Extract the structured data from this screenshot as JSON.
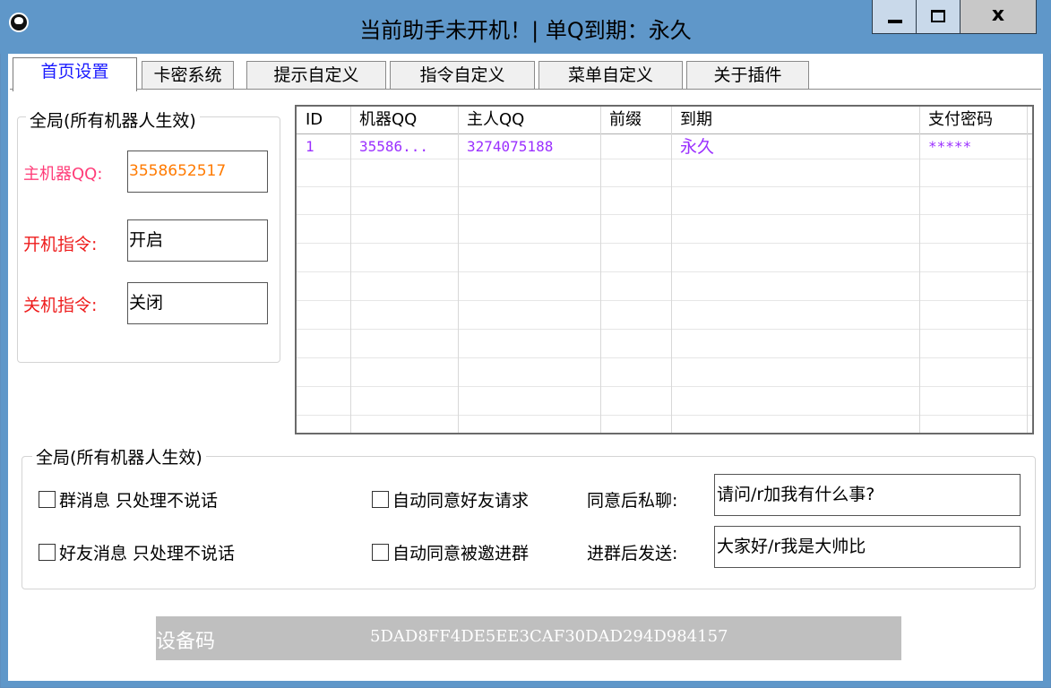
{
  "window": {
    "title": "当前助手未开机！| 单Q到期：永久",
    "close_glyph": "x"
  },
  "tabs": [
    {
      "label": "首页设置",
      "active": true
    },
    {
      "label": "卡密系统",
      "active": false
    },
    {
      "label": "提示自定义",
      "active": false
    },
    {
      "label": "指令自定义",
      "active": false
    },
    {
      "label": "菜单自定义",
      "active": false
    },
    {
      "label": "关于插件",
      "active": false
    }
  ],
  "global_group": {
    "legend": "全局(所有机器人生效)",
    "main_qq_label": "主机器QQ:",
    "main_qq_value": "3558652517",
    "on_cmd_label": "开机指令:",
    "on_cmd_value": "开启",
    "off_cmd_label": "关机指令:",
    "off_cmd_value": "关闭"
  },
  "table": {
    "columns": [
      "ID",
      "机器QQ",
      "主人QQ",
      "前缀",
      "到期",
      "支付密码"
    ],
    "rows": [
      [
        "1",
        "35586...",
        "3274075188",
        "",
        "永久",
        "*****"
      ]
    ]
  },
  "options_group": {
    "legend": "全局(所有机器人生效)",
    "group_msg_label": "群消息 只处理不说话",
    "friend_msg_label": "好友消息 只处理不说话",
    "auto_friend_label": "自动同意好友请求",
    "auto_group_label": "自动同意被邀进群",
    "after_friend_label": "同意后私聊:",
    "after_friend_value": "请问/r加我有什么事?",
    "after_group_label": "进群后发送:",
    "after_group_value": "大家好/r我是大帅比"
  },
  "device": {
    "label": "设备码",
    "code": "5DAD8FF4DE5EE3CAF30DAD294D984157"
  },
  "colors": {
    "titlebar": "#5f97c9",
    "active_tab_text": "#1a1aff",
    "label_red": "#ee1c1c",
    "row_text": "#9b30ff",
    "qq_value": "#ff7a00"
  }
}
